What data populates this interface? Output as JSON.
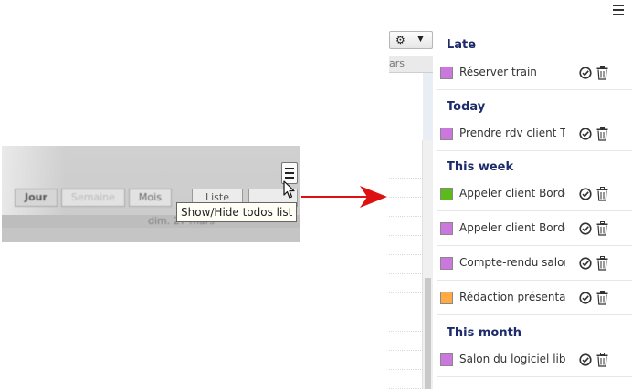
{
  "inset": {
    "buttons": [
      "Jour",
      "Semaine",
      "Mois",
      "Liste"
    ],
    "date_text": "dim. 27 mars",
    "tooltip": "Show/Hide todos list"
  },
  "calendar": {
    "header_fragment": "ars"
  },
  "todos": {
    "groups": [
      {
        "title": "Late",
        "items": [
          {
            "label": "Réserver train",
            "color": "#cc77dd"
          }
        ]
      },
      {
        "title": "Today",
        "items": [
          {
            "label": "Prendre rdv client Tc",
            "color": "#cc77dd"
          }
        ]
      },
      {
        "title": "This week",
        "items": [
          {
            "label": "Appeler client Borde",
            "color": "#5bbb1a"
          },
          {
            "label": "Appeler client Borde",
            "color": "#cc77dd"
          },
          {
            "label": "Compte-rendu salon",
            "color": "#cc77dd"
          },
          {
            "label": "Rédaction présentat",
            "color": "#ffaa44"
          }
        ]
      },
      {
        "title": "This month",
        "items": [
          {
            "label": "Salon du logiciel libi",
            "color": "#cc77dd"
          }
        ]
      }
    ]
  },
  "colors": {
    "arrow": "#dd1111",
    "group_title": "#1d2b6b"
  }
}
